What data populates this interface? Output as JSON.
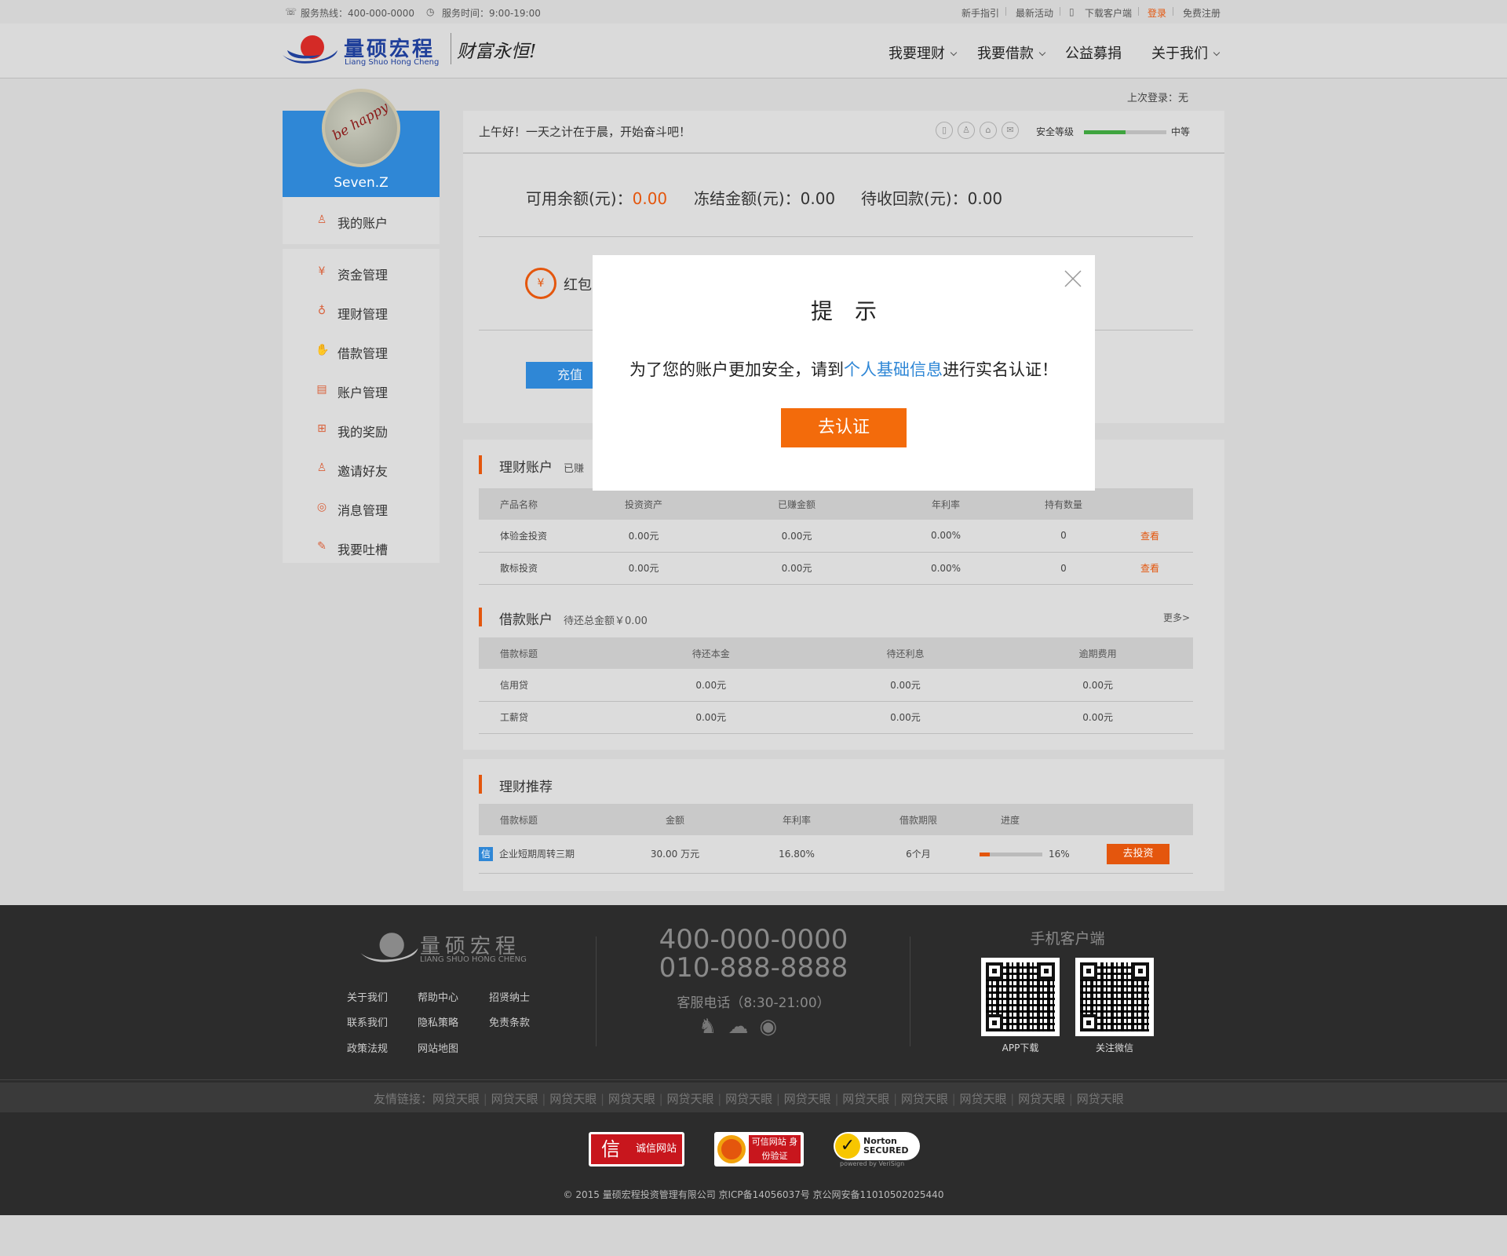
{
  "topbar": {
    "hotline": "服务热线：400-000-0000",
    "hours": "服务时间：9:00-19:00",
    "links": [
      "新手指引",
      "最新活动",
      "下载客户端",
      "登录",
      "免费注册"
    ]
  },
  "header": {
    "logo_cn": "量硕宏程",
    "logo_en": "Liang Shuo Hong Cheng",
    "slogan": "财富永恒!",
    "nav": [
      "我要理财",
      "我要借款",
      "公益募捐",
      "关于我们"
    ]
  },
  "last_login": "上次登录：无",
  "sidebar": {
    "username": "Seven.Z",
    "avatar_text": "be happy",
    "my_account": "我的账户",
    "items": [
      "资金管理",
      "理财管理",
      "借款管理",
      "账户管理",
      "我的奖励",
      "邀请好友",
      "消息管理",
      "我要吐槽"
    ]
  },
  "greeting": "上午好！一天之计在于晨，开始奋斗吧！",
  "security": {
    "label": "安全等级",
    "level": "中等",
    "progress": 0.5
  },
  "balance": {
    "available_label": "可用余额(元)：",
    "available": "0.00",
    "frozen_label": "冻结金额(元)：",
    "frozen": "0.00",
    "pending_label": "待收回款(元)：",
    "pending": "0.00"
  },
  "redpacket_label": "红包",
  "recharge_label": "充值",
  "invest_account": {
    "title": "理财账户",
    "subtitle": "已赚",
    "headers": [
      "产品名称",
      "投资资产",
      "已赚金额",
      "年利率",
      "持有数量",
      ""
    ],
    "rows": [
      [
        "体验金投资",
        "0.00元",
        "0.00元",
        "0.00%",
        "0",
        "查看"
      ],
      [
        "散标投资",
        "0.00元",
        "0.00元",
        "0.00%",
        "0",
        "查看"
      ]
    ]
  },
  "loan_account": {
    "title": "借款账户",
    "subtitle": "待还总金额￥0.00",
    "more": "更多>",
    "headers": [
      "借款标题",
      "待还本金",
      "待还利息",
      "逾期费用"
    ],
    "rows": [
      [
        "信用贷",
        "0.00元",
        "0.00元",
        "0.00元"
      ],
      [
        "工薪贷",
        "0.00元",
        "0.00元",
        "0.00元"
      ]
    ]
  },
  "recommend": {
    "title": "理财推荐",
    "headers": [
      "借款标题",
      "金额",
      "年利率",
      "借款期限",
      "进度",
      ""
    ],
    "row": {
      "badge": "信",
      "name": "企业短期周转三期",
      "amount": "30.00 万元",
      "rate": "16.80%",
      "term": "6个月",
      "progress": 0.16,
      "progress_text": "16%",
      "button": "去投资"
    }
  },
  "modal": {
    "title": "提　示",
    "text_before": "为了您的账户更加安全，请到",
    "link": "个人基础信息",
    "text_after": "进行实名认证！",
    "button": "去认证"
  },
  "footer": {
    "logo_cn": "量硕宏程",
    "logo_en": "LIANG SHUO HONG CHENG",
    "links": [
      "关于我们",
      "帮助中心",
      "招贤纳士",
      "联系我们",
      "隐私策略",
      "免责条款",
      "政策法规",
      "网站地图"
    ],
    "phone1": "400-000-0000",
    "phone2": "010-888-8888",
    "service": "客服电话（8:30-21:00）",
    "mobile_title": "手机客户端",
    "qr1": "APP下载",
    "qr2": "关注微信",
    "friend_label": "友情链接：",
    "friends": [
      "网贷天眼",
      "网贷天眼",
      "网贷天眼",
      "网贷天眼",
      "网贷天眼",
      "网贷天眼",
      "网贷天眼",
      "网贷天眼",
      "网贷天眼",
      "网贷天眼",
      "网贷天眼",
      "网贷天眼"
    ],
    "badges": [
      "诚信网站",
      "可信网站 身份验证",
      "Norton SECURED"
    ],
    "norton_sub": "powered by VeriSign",
    "copyright": "© 2015 量硕宏程投资管理有限公司 京ICP备14056037号 京公网安备11010502025440"
  },
  "colors": {
    "accent": "#e4560d",
    "blue": "#2f87d6",
    "link": "#2f87d6"
  }
}
